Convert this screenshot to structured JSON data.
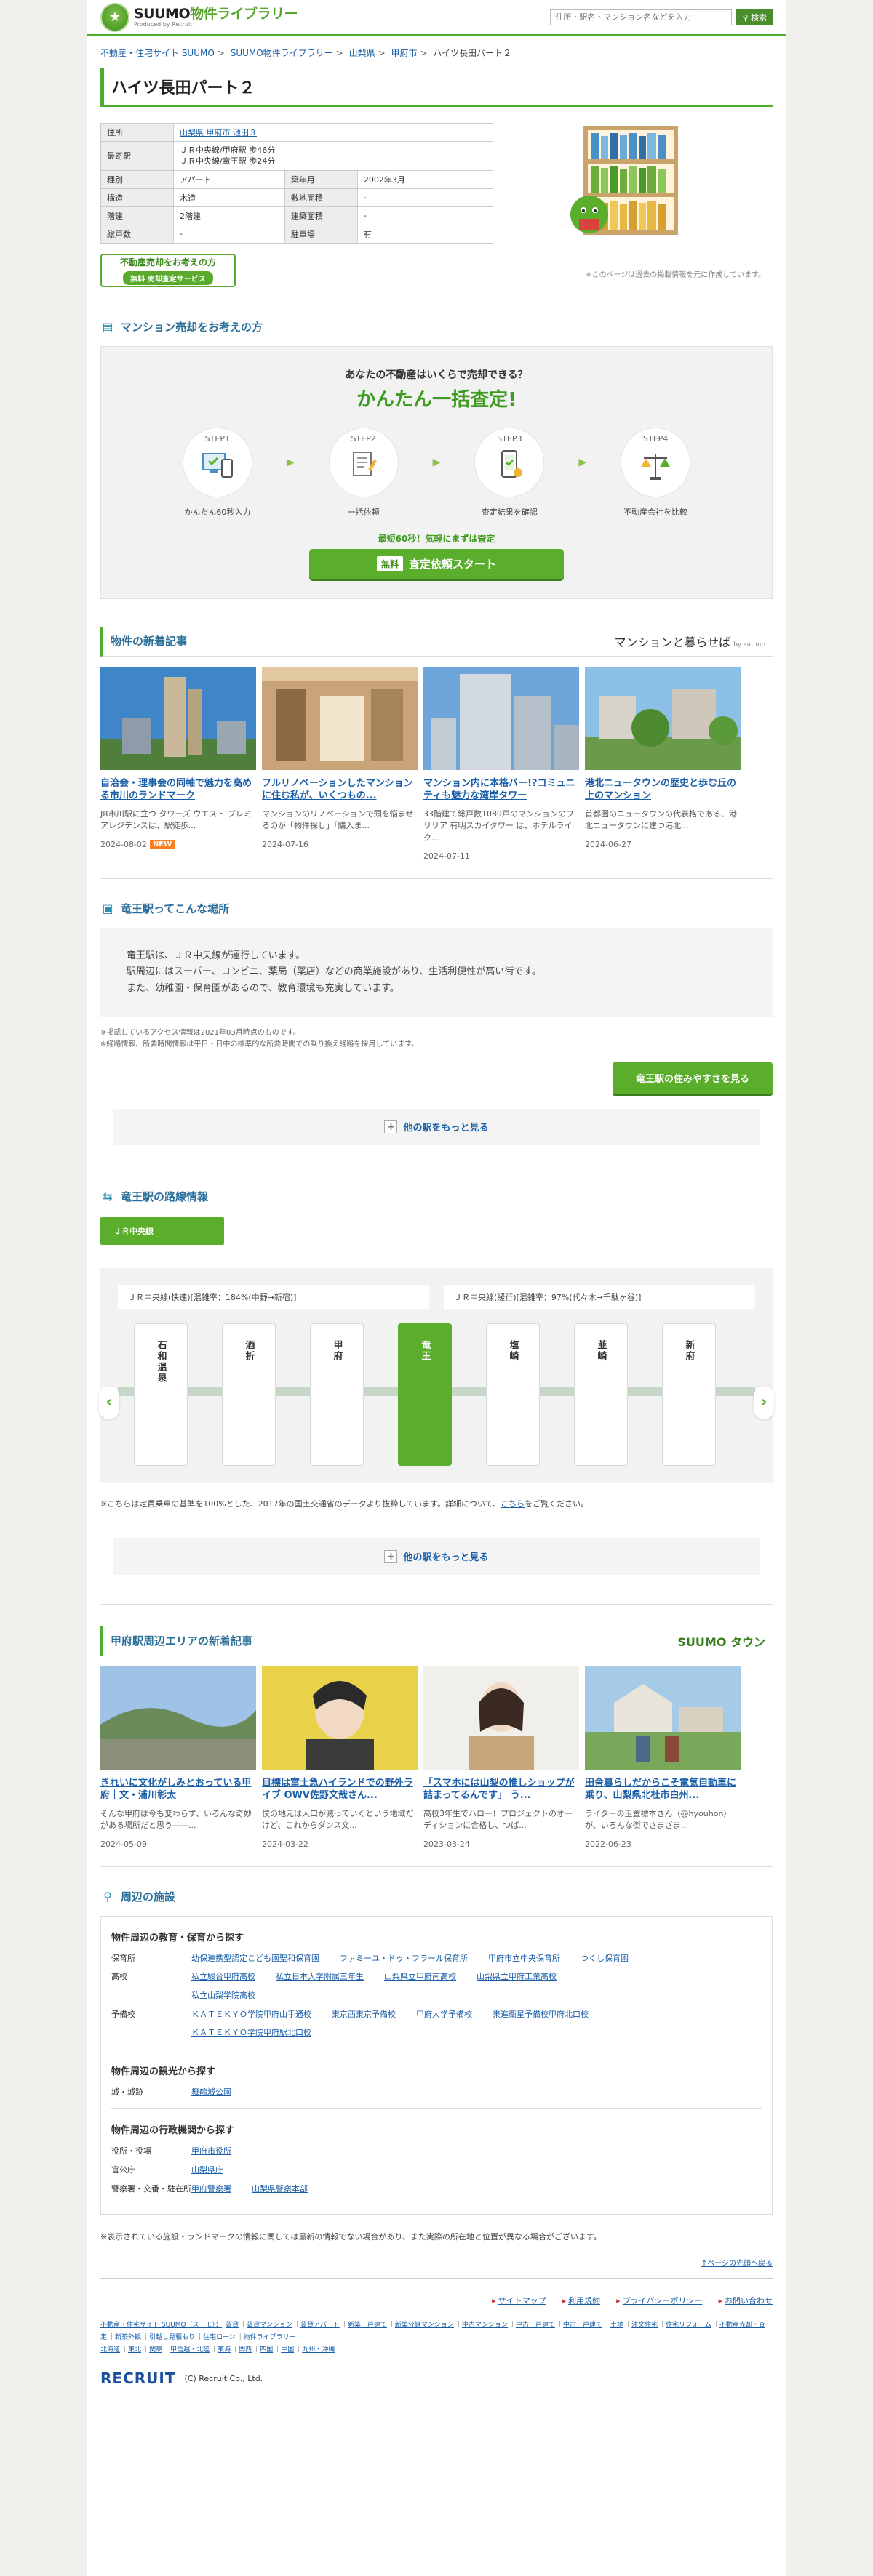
{
  "header": {
    "logo_main": "SUUMO",
    "logo_lib": "物件ライブラリー",
    "logo_sub": "Produced by Recruit",
    "search_placeholder": "住所・駅名・マンション名などを入力",
    "search_button": "検索"
  },
  "breadcrumb": [
    "不動産・住宅サイト SUUMO",
    "SUUMO物件ライブラリー",
    "山梨県",
    "甲府市",
    "ハイツ長田パート２"
  ],
  "property": {
    "title": "ハイツ長田パート２",
    "rows": [
      {
        "label": "住所",
        "value": "山梨県 甲府市 池田３",
        "link": true
      },
      {
        "label": "最寄駅",
        "value": "ＪＲ中央線/甲府駅 歩46分",
        "value2": "ＪＲ中央線/竜王駅 歩24分"
      }
    ],
    "grid": [
      {
        "l1": "種別",
        "v1": "アパート",
        "l2": "築年月",
        "v2": "2002年3月"
      },
      {
        "l1": "構造",
        "v1": "木造",
        "l2": "敷地面積",
        "v2": "-"
      },
      {
        "l1": "階建",
        "v1": "2階建",
        "l2": "建築面積",
        "v2": "-"
      },
      {
        "l1": "総戸数",
        "v1": "-",
        "l2": "駐車場",
        "v2": "有"
      }
    ],
    "sell_title": "不動産売却をお考えの方",
    "sell_pill": "売却査定サービス",
    "sell_pill_prefix": "無料",
    "note": "※このページは過去の掲載情報を元に作成しています。"
  },
  "assess": {
    "heading": "マンション売却をお考えの方",
    "question": "あなたの不動産はいくらで売却できる？",
    "big": "かんたん一括査定!",
    "steps": [
      {
        "label": "STEP1",
        "caption": "かんたん60秒入力"
      },
      {
        "label": "STEP2",
        "caption": "一括依頼"
      },
      {
        "label": "STEP3",
        "caption": "査定結果を確認"
      },
      {
        "label": "STEP4",
        "caption": "不動産会社を比較"
      }
    ],
    "note": "最短60秒！気軽にまずは査定",
    "button_free": "無料",
    "button": "査定依頼スタート"
  },
  "new_articles": {
    "heading": "物件の新着記事",
    "brand": "マンションと暮らせば",
    "brand_sub": "by suumo",
    "items": [
      {
        "title": "自治会・理事会の同軸で魅力を高める市川のランドマーク",
        "text": "JR市川駅に立つ タワーズ ウエスト プレミアレジデンスは、駅徒歩...",
        "date": "2024-08-02",
        "new": "NEW"
      },
      {
        "title": "フルリノベーションしたマンションに住む私が、いくつもの...",
        "text": "マンションのリノベーションで頭を悩ませるのが「物件探し」「購入ま...",
        "date": "2024-07-16",
        "new": ""
      },
      {
        "title": "マンション内に本格バー!?コミュニティも魅力な湾岸タワー",
        "text": "33階建て総戸数1089戸のマンションのフリリア 有明スカイタワー は、ホテルライク...",
        "date": "2024-07-11",
        "new": ""
      },
      {
        "title": "港北ニュータウンの歴史と歩む丘の上のマンション",
        "text": "首都圏のニュータウンの代表格である、港北ニュータウンに建つ港北...",
        "date": "2024-06-27",
        "new": ""
      }
    ]
  },
  "station": {
    "heading": "竜王駅ってこんな場所",
    "lines": [
      "竜王駅は、ＪＲ中央線が運行しています。",
      "駅周辺にはスーパー、コンビニ、薬局（薬店）などの商業施設があり、生活利便性が高い街です。",
      "また、幼稚園・保育園があるので、教育環境も充実しています。"
    ],
    "notes": [
      "※掲載しているアクセス情報は2021年03月時点のものです。",
      "※経路情報、所要時間情報は平日・日中の標準的な所要時間での乗り換え経路を採用しています。"
    ],
    "button": "竜王駅の住みやすさを見る",
    "more": "他の駅をもっと見る"
  },
  "route": {
    "heading": "竜王駅の路線情報",
    "tab": "ＪＲ中央線",
    "congestion": [
      "ＪＲ中央線(快速)[混雑率：184%(中野→新宿)]",
      "ＪＲ中央線(緩行)[混雑率：97%(代々木→千駄ヶ谷)]"
    ],
    "stations": [
      "石和温泉",
      "酒折",
      "甲府",
      "竜王",
      "塩崎",
      "韮崎",
      "新府"
    ],
    "current": "竜王",
    "note_before": "※こちらは定員乗車の基準を100%とした、2017年の国土交通省のデータより抜粋しています。詳細について、",
    "note_link": "こちら",
    "note_after": "をご覧ください。",
    "more": "他の駅をもっと見る"
  },
  "area_articles": {
    "heading": "甲府駅周辺エリアの新着記事",
    "brand": "SUUMO タウン",
    "items": [
      {
        "title": "きれいに文化がしみとおっている甲府｜文・浦川彰太",
        "text": "そんな甲府は今も変わらず、いろんな奇妙がある場所だと思う――...",
        "date": "2024-05-09"
      },
      {
        "title": "目標は富士急ハイランドでの野外ライブ OWV佐野文哉さん...",
        "text": "僕の地元は人口が減っていくという地域だけど、これからダンス文...",
        "date": "2024-03-22"
      },
      {
        "title": "「スマホには山梨の推しショップが詰まってるんです」 う...",
        "text": "高校3年生でハロー！プロジェクトのオーディションに合格し、つば...",
        "date": "2023-03-24"
      },
      {
        "title": "田舎暮らしだからこそ電気自動車に乗り、山梨県北杜市白州...",
        "text": "ライターの玉置標本さん（@hyouhon）が、いろんな街でさまざま...",
        "date": "2022-06-23"
      }
    ]
  },
  "facilities": {
    "heading": "周辺の施設",
    "edu_title": "物件周辺の教育・保育から探す",
    "edu": [
      {
        "label": "保育所",
        "links": [
          "幼保連携型認定こども園聖和保育園",
          "ファミーユ・ドゥ・フラール保育所",
          "甲府市立中央保育所",
          "つくし保育園"
        ]
      },
      {
        "label": "高校",
        "links": [
          "私立駿台甲府高校",
          "私立日本大学附属三年生",
          "山梨県立甲府南高校",
          "山梨県立甲府工業高校"
        ]
      },
      {
        "label": "",
        "links": [
          "私立山梨学院高校"
        ]
      },
      {
        "label": "予備校",
        "links": [
          "ＫＡＴＥＫＹＯ学院甲府山手通校",
          "東京西東京予備校",
          "甲府大学予備校",
          "東進衛星予備校甲府北口校"
        ]
      },
      {
        "label": "",
        "links": [
          "ＫＡＴＥＫＹＯ学院甲府駅北口校"
        ]
      }
    ],
    "sight_title": "物件周辺の観光から探す",
    "sight": [
      {
        "label": "城・城跡",
        "links": [
          "舞鶴城公園"
        ]
      }
    ],
    "gov_title": "物件周辺の行政機関から探す",
    "gov": [
      {
        "label": "役所・役場",
        "links": [
          "甲府市役所"
        ]
      },
      {
        "label": "官公庁",
        "links": [
          "山梨県庁"
        ]
      },
      {
        "label": "警察署・交番・駐在所",
        "links": [
          "甲府警察署",
          "山梨県警察本部"
        ]
      }
    ],
    "footnote": "※表示されている施設・ランドマークの情報に関しては最新の情報でない場合があり、また実際の所在地と位置が異なる場合がございます。"
  },
  "top_link": "↑ページの先頭へ戻る",
  "footer": {
    "links": [
      "サイトマップ",
      "利用規約",
      "プライバシーポリシー",
      "お問い合わせ"
    ],
    "site_prefix": "不動産・住宅サイト SUUMO（スーモ）：",
    "site_links": [
      "賃貸",
      "賃貸マンション",
      "賃貸アパート",
      "新築一戸建て",
      "新築分譲マンション",
      "中古マンション",
      "中古一戸建て",
      "中古一戸建て",
      "土地",
      "注文住宅",
      "住宅リフォーム",
      "不動産売却・査定",
      "新築外観",
      "引越し見積もり",
      "住宅ローン",
      "物件ライブラリー"
    ],
    "site_regions": [
      "北海道",
      "東北",
      "関東",
      "甲信越・北陸",
      "東海",
      "関西",
      "四国",
      "中国",
      "九州・沖縄"
    ],
    "recruit": "RECRUIT",
    "copyright": "(C) Recruit Co., Ltd."
  }
}
